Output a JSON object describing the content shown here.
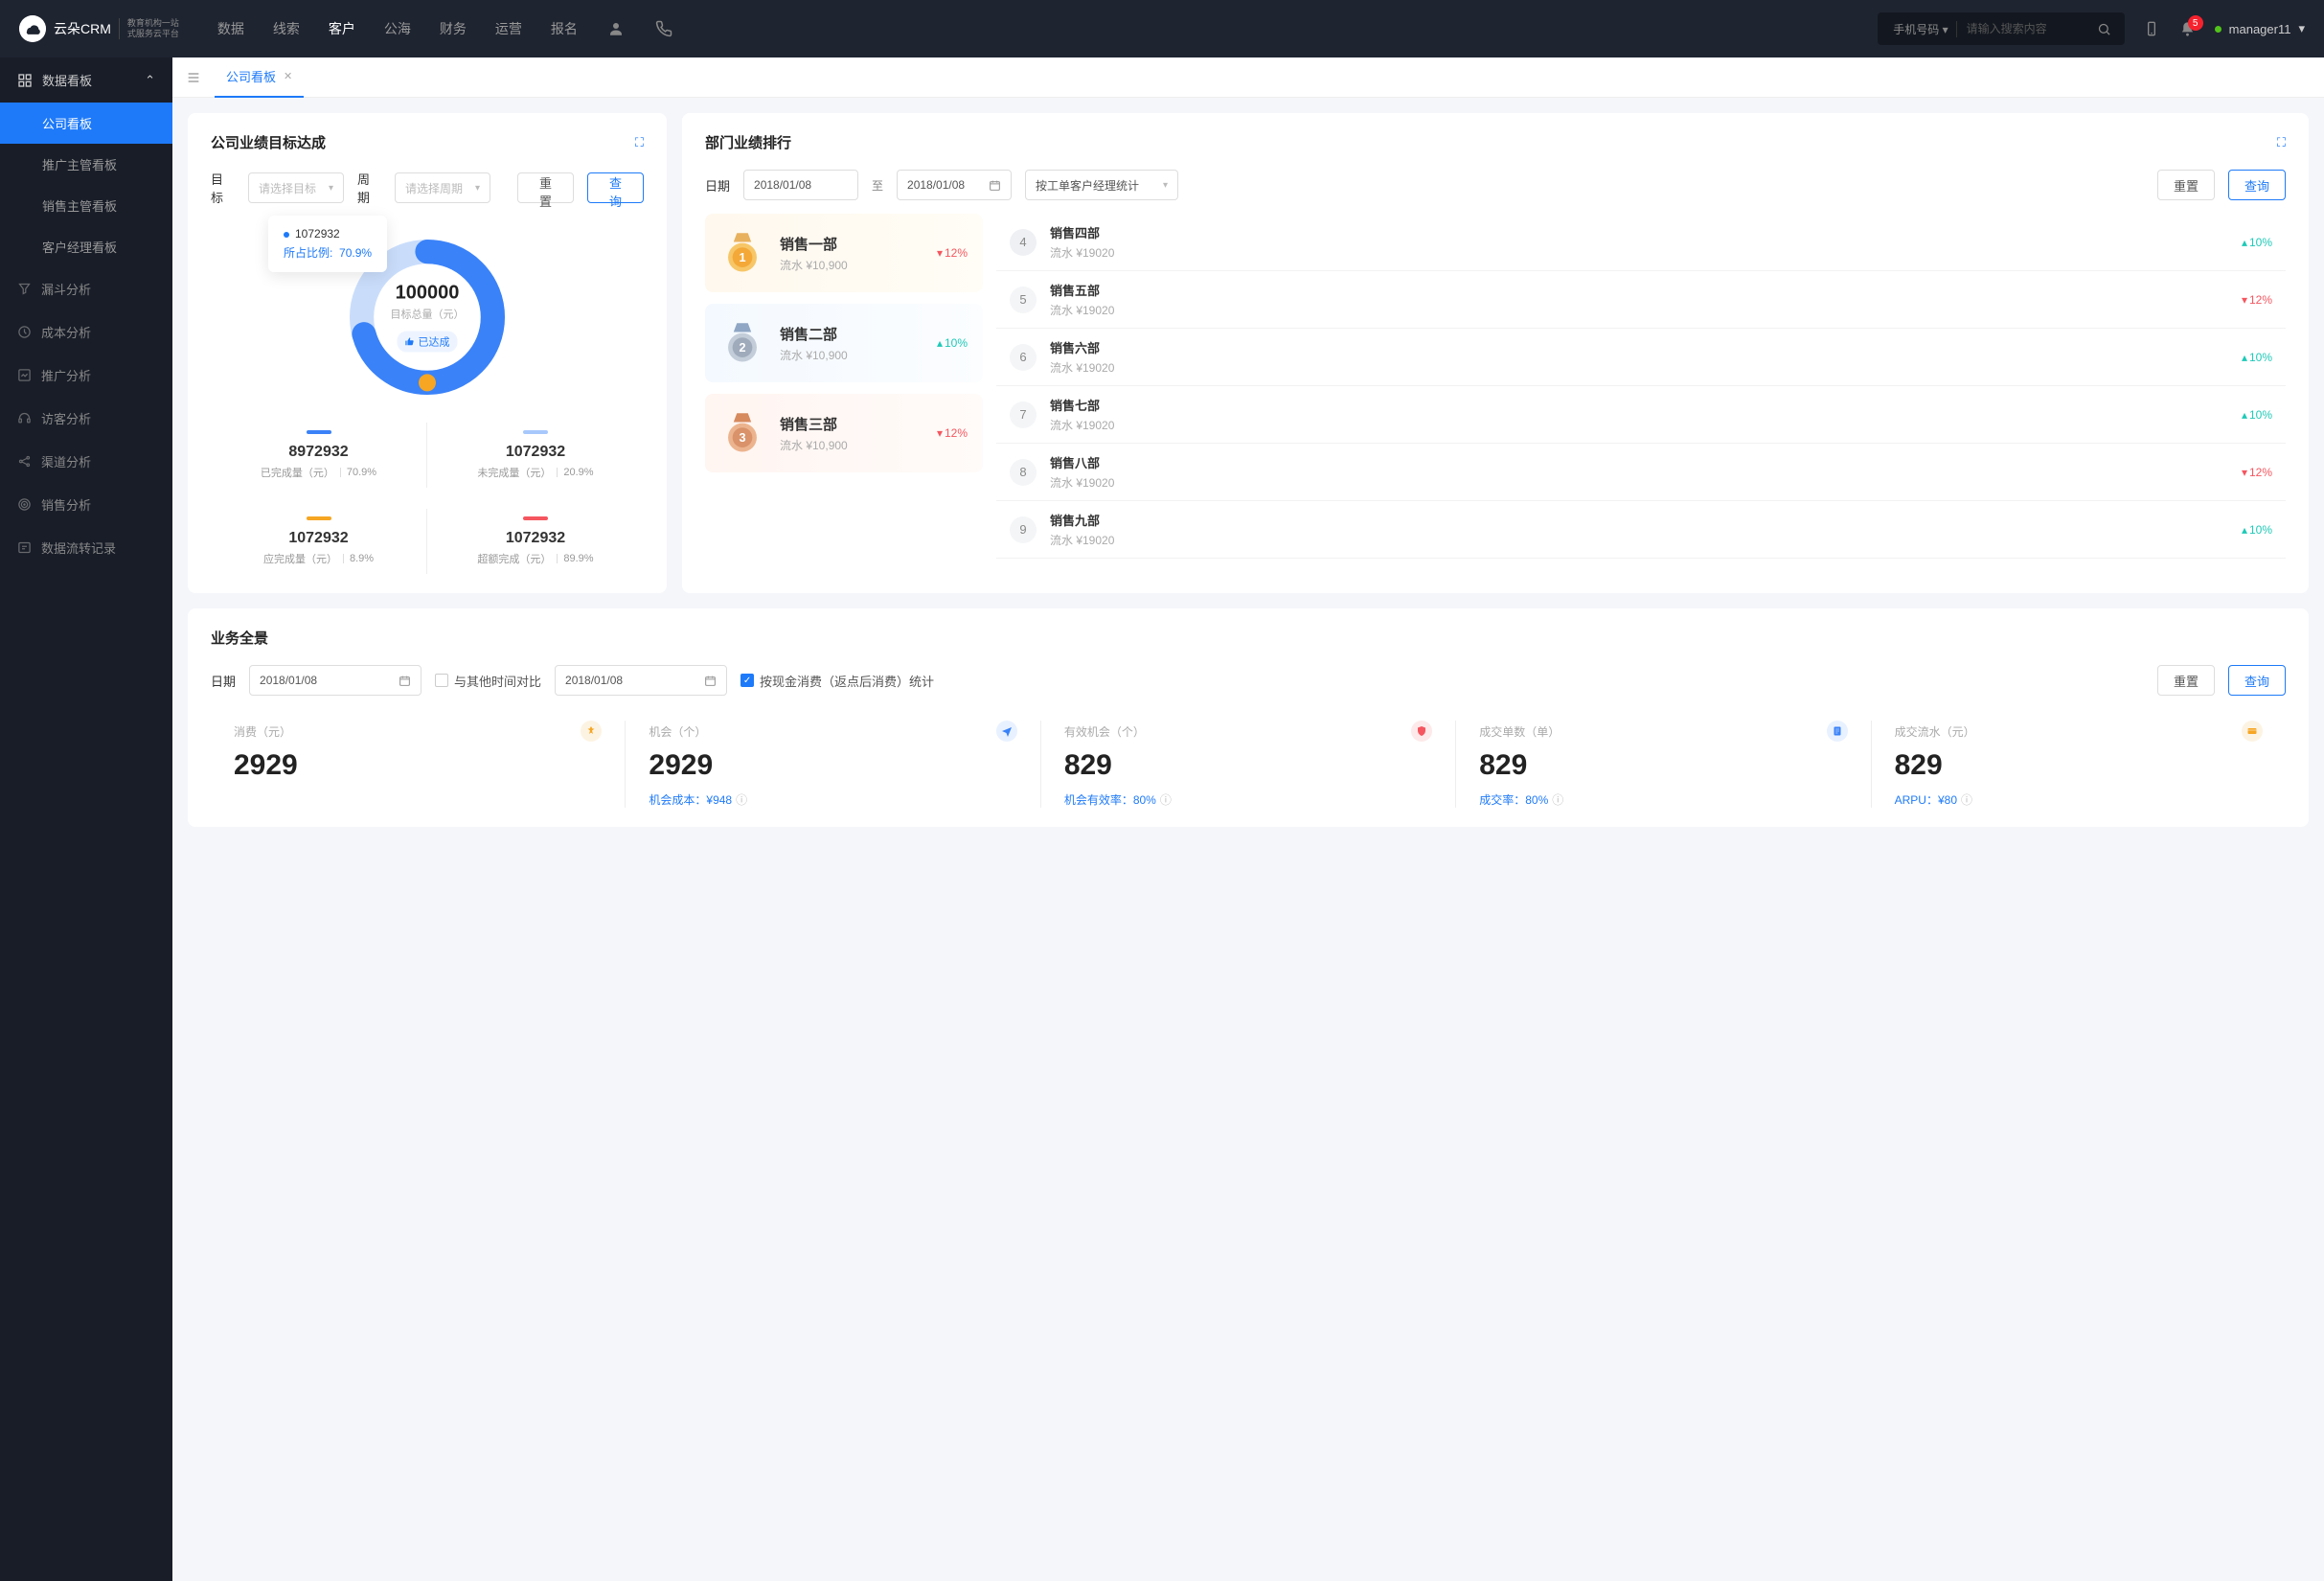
{
  "header": {
    "logo_text": "云朵CRM",
    "logo_sub1": "教育机构一站",
    "logo_sub2": "式服务云平台",
    "nav": [
      "数据",
      "线索",
      "客户",
      "公海",
      "财务",
      "运营",
      "报名"
    ],
    "nav_active": 2,
    "search_type": "手机号码",
    "search_placeholder": "请输入搜索内容",
    "badge": "5",
    "user": "manager11"
  },
  "sidebar": {
    "group_title": "数据看板",
    "items": [
      "公司看板",
      "推广主管看板",
      "销售主管看板",
      "客户经理看板"
    ],
    "item_active": 0,
    "links": [
      "漏斗分析",
      "成本分析",
      "推广分析",
      "访客分析",
      "渠道分析",
      "销售分析",
      "数据流转记录"
    ]
  },
  "tab": {
    "label": "公司看板"
  },
  "goal": {
    "title": "公司业绩目标达成",
    "target_label": "目标",
    "target_placeholder": "请选择目标",
    "period_label": "周期",
    "period_placeholder": "请选择周期",
    "reset": "重置",
    "query": "查询",
    "tooltip_value": "1072932",
    "tooltip_ratio_label": "所占比例:",
    "tooltip_ratio_value": "70.9%",
    "center_value": "100000",
    "center_label": "目标总量（元）",
    "center_badge": "已达成",
    "stats": [
      {
        "color": "#3a82f8",
        "value": "8972932",
        "label": "已完成量（元）",
        "pct": "70.9%"
      },
      {
        "color": "#a7c8fb",
        "value": "1072932",
        "label": "未完成量（元）",
        "pct": "20.9%"
      },
      {
        "color": "#f6a623",
        "value": "1072932",
        "label": "应完成量（元）",
        "pct": "8.9%"
      },
      {
        "color": "#f5565f",
        "value": "1072932",
        "label": "超额完成（元）",
        "pct": "89.9%"
      }
    ]
  },
  "rank": {
    "title": "部门业绩排行",
    "date_label": "日期",
    "date_from": "2018/01/08",
    "date_sep": "至",
    "date_to": "2018/01/08",
    "mode": "按工单客户经理统计",
    "reset": "重置",
    "query": "查询",
    "top": [
      {
        "n": "1",
        "name": "销售一部",
        "amt": "流水 ¥10,900",
        "pct": "12%",
        "dir": "down"
      },
      {
        "n": "2",
        "name": "销售二部",
        "amt": "流水 ¥10,900",
        "pct": "10%",
        "dir": "up"
      },
      {
        "n": "3",
        "name": "销售三部",
        "amt": "流水 ¥10,900",
        "pct": "12%",
        "dir": "down"
      }
    ],
    "list": [
      {
        "n": "4",
        "name": "销售四部",
        "amt": "流水 ¥19020",
        "pct": "10%",
        "dir": "up"
      },
      {
        "n": "5",
        "name": "销售五部",
        "amt": "流水 ¥19020",
        "pct": "12%",
        "dir": "down"
      },
      {
        "n": "6",
        "name": "销售六部",
        "amt": "流水 ¥19020",
        "pct": "10%",
        "dir": "up"
      },
      {
        "n": "7",
        "name": "销售七部",
        "amt": "流水 ¥19020",
        "pct": "10%",
        "dir": "up"
      },
      {
        "n": "8",
        "name": "销售八部",
        "amt": "流水 ¥19020",
        "pct": "12%",
        "dir": "down"
      },
      {
        "n": "9",
        "name": "销售九部",
        "amt": "流水 ¥19020",
        "pct": "10%",
        "dir": "up"
      }
    ]
  },
  "biz": {
    "title": "业务全景",
    "date_label": "日期",
    "date1": "2018/01/08",
    "compare_label": "与其他时间对比",
    "date2": "2018/01/08",
    "by_cash_label": "按现金消费（返点后消费）统计",
    "reset": "重置",
    "query": "查询",
    "kpi": [
      {
        "label": "消费（元）",
        "value": "2929",
        "sub": "",
        "icon": "money",
        "color": "#f6a623"
      },
      {
        "label": "机会（个）",
        "value": "2929",
        "sub": "机会成本：¥948",
        "icon": "send",
        "color": "#3a82f8"
      },
      {
        "label": "有效机会（个）",
        "value": "829",
        "sub": "机会有效率：80%",
        "icon": "shield",
        "color": "#f5565f"
      },
      {
        "label": "成交单数（单）",
        "value": "829",
        "sub": "成交率：80%",
        "icon": "doc",
        "color": "#3a82f8"
      },
      {
        "label": "成交流水（元）",
        "value": "829",
        "sub": "ARPU：¥80",
        "icon": "card",
        "color": "#f6a623"
      }
    ]
  },
  "chart_data": {
    "type": "pie",
    "title": "目标总量（元）",
    "total": 100000,
    "series": [
      {
        "name": "已完成量（元）",
        "value": 8972932,
        "pct": 70.9,
        "color": "#3a82f8"
      },
      {
        "name": "未完成量（元）",
        "value": 1072932,
        "pct": 20.9,
        "color": "#a7c8fb"
      },
      {
        "name": "应完成量（元）",
        "value": 1072932,
        "pct": 8.9,
        "color": "#f6a623"
      },
      {
        "name": "超额完成（元）",
        "value": 1072932,
        "pct": 89.9,
        "color": "#f5565f"
      }
    ]
  }
}
